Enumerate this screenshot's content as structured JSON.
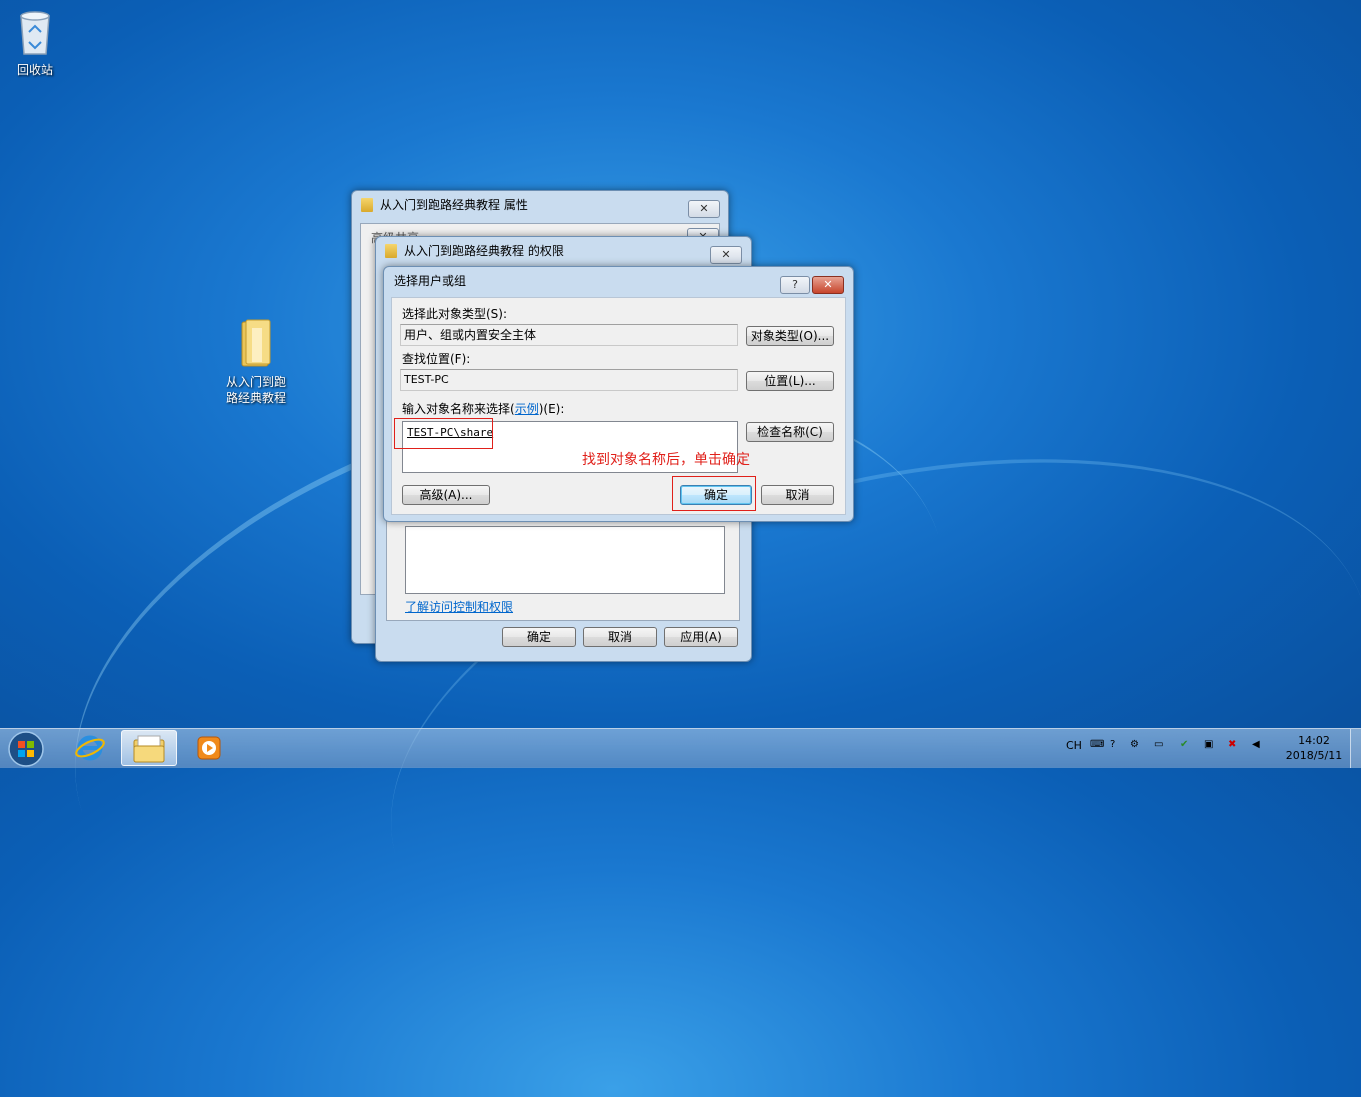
{
  "desktop": {
    "icons": [
      {
        "label": "回收站",
        "icon": "recycle-bin-icon"
      },
      {
        "label": "从入门到跑路经典教程",
        "icon": "folder-icon"
      }
    ]
  },
  "properties_window": {
    "title": "从入门到跑路经典教程 属性",
    "tab_label": "高级共享"
  },
  "permissions_window": {
    "title": "从入门到跑路经典教程 的权限",
    "link": "了解访问控制和权限",
    "buttons": {
      "ok": "确定",
      "cancel": "取消",
      "apply": "应用(A)"
    }
  },
  "select_dialog": {
    "title": "选择用户或组",
    "help_label": "?",
    "close_label": "✕",
    "object_type_label": "选择此对象类型(S):",
    "object_type_value": "用户、组或内置安全主体",
    "object_type_button": "对象类型(O)...",
    "location_label": "查找位置(F):",
    "location_value": "TEST-PC",
    "location_button": "位置(L)...",
    "names_label_prefix": "输入对象名称来选择(",
    "names_label_link": "示例",
    "names_label_suffix": ")(E):",
    "names_value": "TEST-PC\\share",
    "check_names_button": "检查名称(C)",
    "advanced_button": "高级(A)...",
    "ok_button": "确定",
    "cancel_button": "取消"
  },
  "annotation": {
    "text": "找到对象名称后，单击确定",
    "color": "#e0201a"
  },
  "taskbar": {
    "items": [
      "start-orb-icon",
      "internet-explorer-icon",
      "windows-explorer-icon",
      "media-player-icon"
    ],
    "tray": {
      "language": "CH",
      "time": "14:02",
      "date": "2018/5/11"
    }
  }
}
